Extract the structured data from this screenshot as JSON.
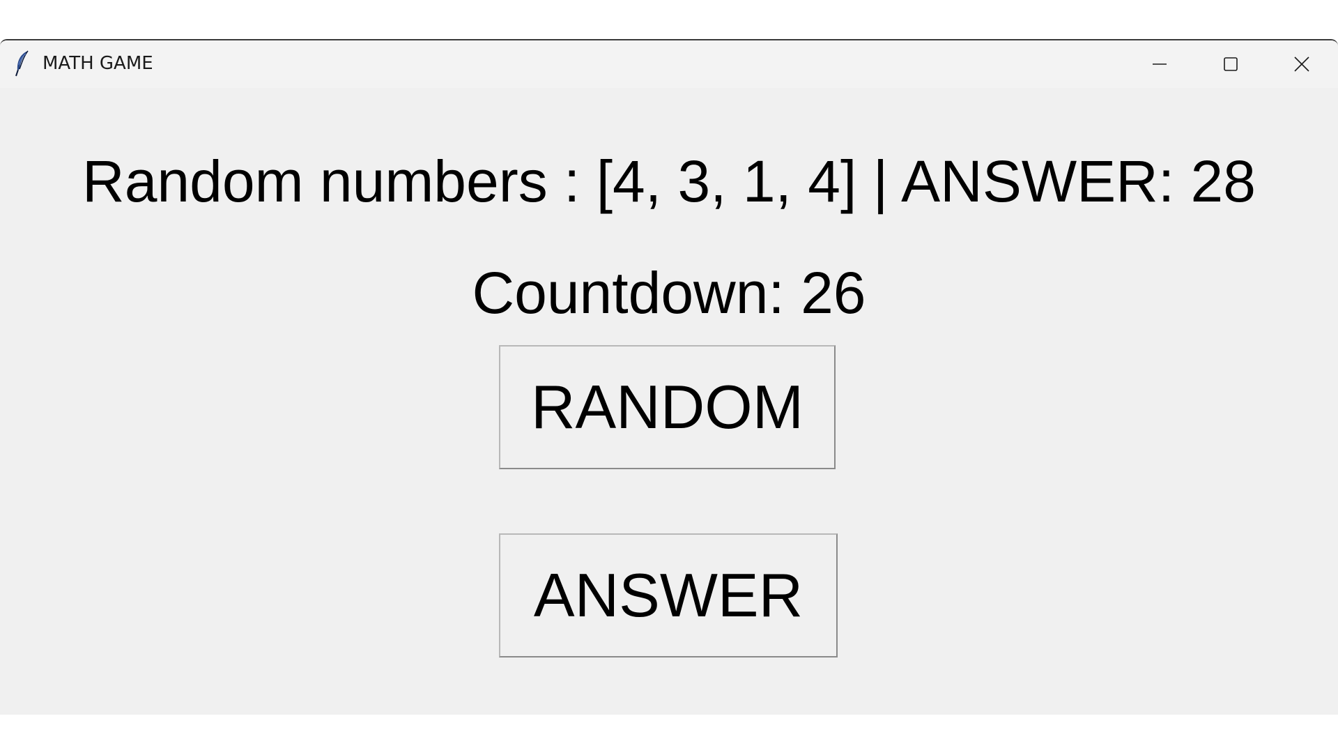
{
  "window": {
    "title": "MATH GAME",
    "app_icon": "feather-icon",
    "controls": {
      "minimize_icon": "minimize-icon",
      "maximize_icon": "maximize-icon",
      "close_icon": "close-icon"
    }
  },
  "main": {
    "numbers_text": "Random numbers : [4, 3, 1, 4] | ANSWER: 28",
    "countdown_text": "Countdown: 26",
    "random_button_label": "RANDOM",
    "answer_button_label": "ANSWER"
  },
  "colors": {
    "window_background": "#f0f0f0",
    "titlebar_background": "#f3f3f3",
    "text": "#000000"
  }
}
